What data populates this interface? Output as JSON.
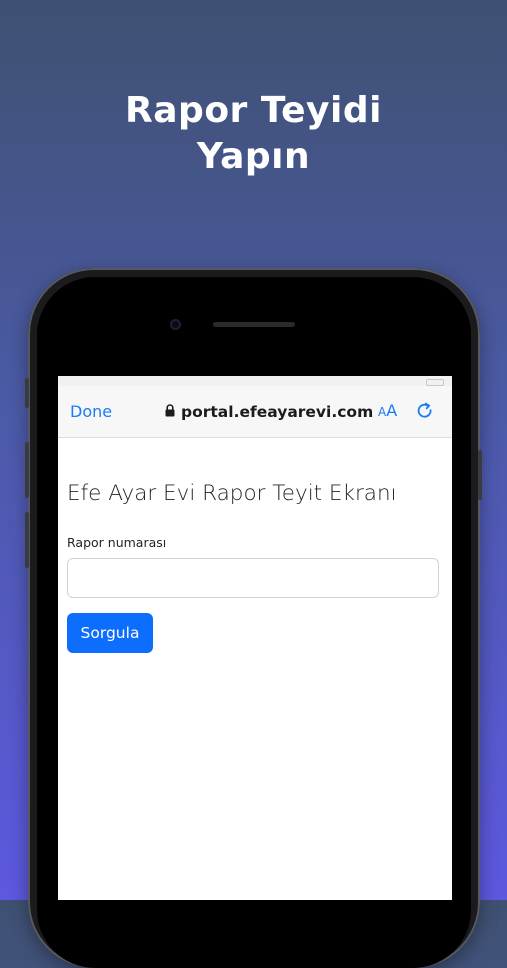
{
  "headline": {
    "line1": "Rapor Teyidi",
    "line2": "Yapın"
  },
  "browser": {
    "done_label": "Done",
    "url": "portal.efeayarevi.com",
    "text_size_small": "A",
    "text_size_big": "A",
    "accent_color": "#1a7cf2"
  },
  "page": {
    "title": "Efe Ayar Evi Rapor Teyit Ekranı",
    "field_label": "Rapor numarası",
    "field_value": "",
    "field_placeholder": "",
    "submit_label": "Sorgula",
    "button_color": "#0d6efd"
  },
  "icons": [
    "lock-icon",
    "reload-icon"
  ]
}
